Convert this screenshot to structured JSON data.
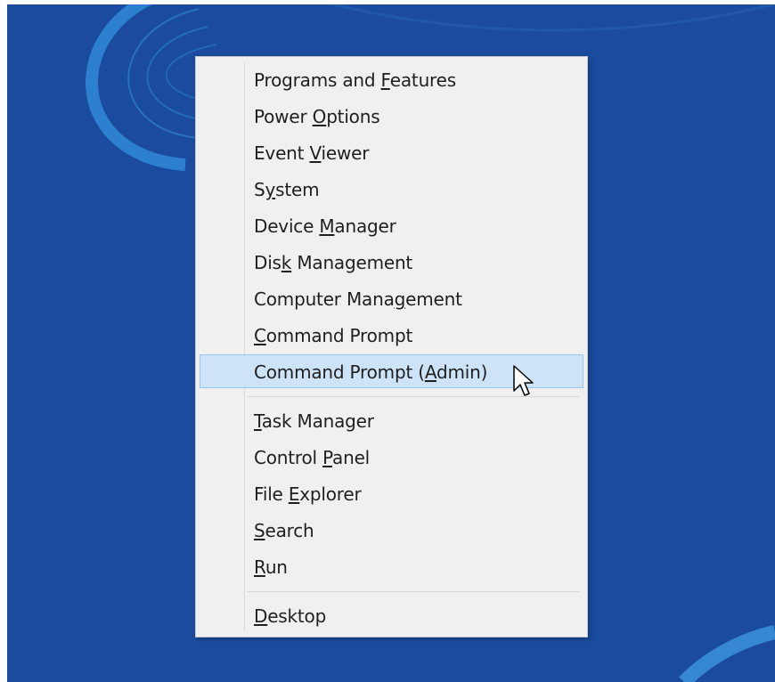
{
  "desktop": {
    "background_color": "#1a4b9e",
    "accent_color": "#3b8fd8"
  },
  "context_menu": {
    "groups": [
      {
        "items": [
          {
            "pre": "Programs and ",
            "key": "F",
            "post": "eatures"
          },
          {
            "pre": "Power ",
            "key": "O",
            "post": "ptions"
          },
          {
            "pre": "Event ",
            "key": "V",
            "post": "iewer"
          },
          {
            "pre": "S",
            "key": "y",
            "post": "stem"
          },
          {
            "pre": "Device ",
            "key": "M",
            "post": "anager"
          },
          {
            "pre": "Dis",
            "key": "k",
            "post": " Management"
          },
          {
            "pre": "Computer Mana",
            "key": "g",
            "post": "ement"
          },
          {
            "pre": "",
            "key": "C",
            "post": "ommand Prompt"
          },
          {
            "pre": "Command Prompt (",
            "key": "A",
            "post": "dmin)"
          }
        ]
      },
      {
        "items": [
          {
            "pre": "",
            "key": "T",
            "post": "ask Manager"
          },
          {
            "pre": "Control ",
            "key": "P",
            "post": "anel"
          },
          {
            "pre": "File ",
            "key": "E",
            "post": "xplorer"
          },
          {
            "pre": "",
            "key": "S",
            "post": "earch"
          },
          {
            "pre": "",
            "key": "R",
            "post": "un"
          }
        ]
      },
      {
        "items": [
          {
            "pre": "",
            "key": "D",
            "post": "esktop"
          }
        ]
      }
    ],
    "highlighted_item": "Command Prompt (Admin)",
    "highlight_color": "#cde3f7"
  },
  "pointer": {
    "icon": "arrow-cursor-icon"
  }
}
